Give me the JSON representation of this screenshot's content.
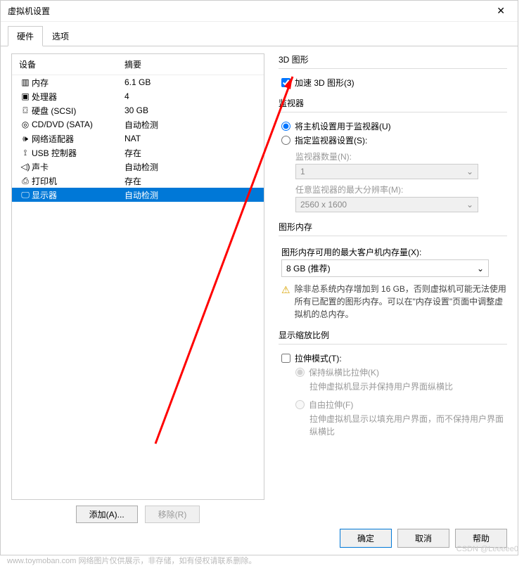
{
  "window": {
    "title": "虚拟机设置",
    "close": "✕"
  },
  "tabs": {
    "hardware": "硬件",
    "options": "选项"
  },
  "hw_header": {
    "device": "设备",
    "summary": "摘要"
  },
  "hardware_list": [
    {
      "icon": "▥",
      "name": "内存",
      "summary": "6.1 GB"
    },
    {
      "icon": "▣",
      "name": "处理器",
      "summary": "4"
    },
    {
      "icon": "⌼",
      "name": "硬盘 (SCSI)",
      "summary": "30 GB"
    },
    {
      "icon": "◎",
      "name": "CD/DVD (SATA)",
      "summary": "自动检测"
    },
    {
      "icon": "🕪",
      "name": "网络适配器",
      "summary": "NAT"
    },
    {
      "icon": "⟟",
      "name": "USB 控制器",
      "summary": "存在"
    },
    {
      "icon": "◁)",
      "name": "声卡",
      "summary": "自动检测"
    },
    {
      "icon": "⎙",
      "name": "打印机",
      "summary": "存在"
    },
    {
      "icon": "🖵",
      "name": "显示器",
      "summary": "自动检测"
    }
  ],
  "buttons": {
    "add": "添加(A)...",
    "remove": "移除(R)"
  },
  "sec_3d": {
    "title": "3D 图形",
    "accel": "加速 3D 图形(3)"
  },
  "sec_monitor": {
    "title": "监视器",
    "use_host": "将主机设置用于监视器(U)",
    "specify": "指定监视器设置(S):",
    "count_label": "监视器数量(N):",
    "count_value": "1",
    "maxres_label": "任意监视器的最大分辨率(M):",
    "maxres_value": "2560 x 1600"
  },
  "sec_gmem": {
    "title": "图形内存",
    "label": "图形内存可用的最大客户机内存量(X):",
    "value": "8 GB (推荐)",
    "warn_icon": "⚠",
    "warn": "除非总系统内存增加到 16 GB，否则虚拟机可能无法使用所有已配置的图形内存。可以在\"内存设置\"页面中调整虚拟机的总内存。"
  },
  "sec_scale": {
    "title": "显示缩放比例",
    "stretch": "拉伸模式(T):",
    "keep_ratio": "保持纵横比拉伸(K)",
    "keep_ratio_desc": "拉伸虚拟机显示并保持用户界面纵横比",
    "free": "自由拉伸(F)",
    "free_desc": "拉伸虚拟机显示以填充用户界面，而不保持用户界面纵横比"
  },
  "footer": {
    "ok": "确定",
    "cancel": "取消",
    "help": "帮助"
  },
  "watermark": "www.toymoban.com 网络图片仅供展示，非存储，如有侵权请联系删除。",
  "csdn": "CSDN @Leeeee0"
}
